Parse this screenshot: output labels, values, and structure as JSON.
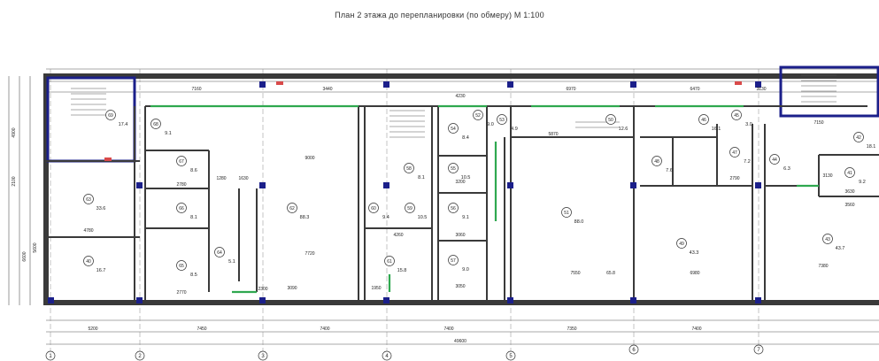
{
  "title": "План 2 этажа до перепланировки (по обмеру) М 1:100",
  "colors": {
    "wall": "#3a3a3a",
    "window": "#2fa84f",
    "accent": "#1b1f8a",
    "door_red": "#d94a4a"
  },
  "axes": [
    "1",
    "2",
    "3",
    "4",
    "5",
    "6",
    "7"
  ],
  "overall_dimension": "49600",
  "bottom_dims": [
    "5200",
    "7450",
    "7400",
    "7400",
    "7350",
    "7400"
  ],
  "top_dims": [
    "7160",
    "3440",
    "4230",
    "6970",
    "6470",
    "3130",
    "7150"
  ],
  "left_dims": [
    "4900",
    "2100",
    "6600",
    "5600"
  ],
  "rooms": [
    {
      "num": "69",
      "area": "17.4"
    },
    {
      "num": "68",
      "area": "9.1"
    },
    {
      "num": "67",
      "area": "8.6"
    },
    {
      "num": "66",
      "area": "8.1"
    },
    {
      "num": "65",
      "area": "8.5"
    },
    {
      "num": "64",
      "area": "5.1"
    },
    {
      "num": "63",
      "area": "33.6"
    },
    {
      "num": "62",
      "area": "88.3"
    },
    {
      "num": "61",
      "area": "15.8"
    },
    {
      "num": "60",
      "area": "9.4"
    },
    {
      "num": "59",
      "area": "10.5"
    },
    {
      "num": "58",
      "area": "8.1"
    },
    {
      "num": "57",
      "area": "9.0"
    },
    {
      "num": "56",
      "area": "9.1"
    },
    {
      "num": "55",
      "area": "10.5"
    },
    {
      "num": "54",
      "area": "8.4"
    },
    {
      "num": "53",
      "area": "4.9"
    },
    {
      "num": "52",
      "area": "9.0"
    },
    {
      "num": "51",
      "area": "88.0"
    },
    {
      "num": "50",
      "area": "12.6"
    },
    {
      "num": "49",
      "area": "43.3"
    },
    {
      "num": "48",
      "area": "7.6"
    },
    {
      "num": "47",
      "area": "7.2"
    },
    {
      "num": "46",
      "area": "16.1"
    },
    {
      "num": "45",
      "area": "3.0"
    },
    {
      "num": "44",
      "area": "6.3"
    },
    {
      "num": "43",
      "area": "43.7"
    },
    {
      "num": "42",
      "area": "18.1"
    },
    {
      "num": "41",
      "area": "9.2"
    },
    {
      "num": "40",
      "area": "16.7"
    }
  ],
  "misc_dims": [
    "9000",
    "7720",
    "3090",
    "1950",
    "4260",
    "3060",
    "3050",
    "3200",
    "7550",
    "6980",
    "7380",
    "3130",
    "4780",
    "2770",
    "2780",
    "1280",
    "1630",
    "2300",
    "65.8",
    "5870",
    "2790",
    "3630",
    "3560"
  ]
}
